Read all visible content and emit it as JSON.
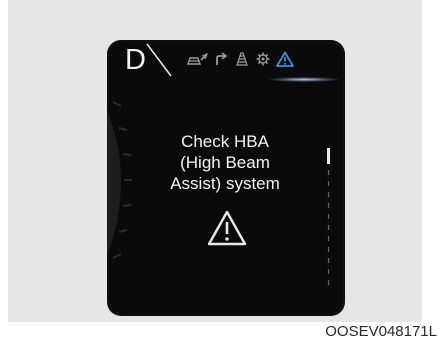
{
  "cluster": {
    "gear": "D",
    "message_lines": [
      "Check HBA",
      "(High Beam",
      "Assist) system"
    ],
    "icons": [
      "drive-mode-icon",
      "turn-arrow-icon",
      "lane-assist-icon",
      "settings-gear-icon",
      "warning-triangle-icon"
    ],
    "accent_color": "#3d8fe0",
    "text_color": "#f3f3f3"
  },
  "caption": "OOSEV048171L"
}
